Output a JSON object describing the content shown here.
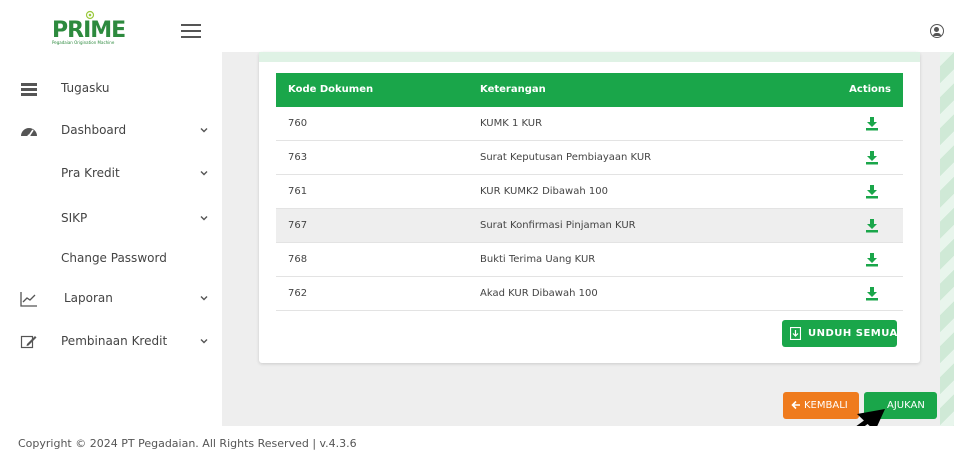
{
  "header": {
    "logo_text": "PRIME",
    "logo_subtitle": "Pegadaian Origination Machine"
  },
  "sidebar": {
    "items": [
      {
        "label": "Tugasku",
        "icon": "tasks-icon"
      },
      {
        "label": "Dashboard",
        "icon": "dashboard-icon"
      },
      {
        "label": "Pra Kredit",
        "icon": ""
      },
      {
        "label": "SIKP",
        "icon": ""
      },
      {
        "label": "Change Password",
        "icon": ""
      },
      {
        "label": "Laporan",
        "icon": "chart-icon"
      },
      {
        "label": "Pembinaan Kredit",
        "icon": "edit-icon"
      }
    ]
  },
  "table": {
    "headers": [
      "Kode Dokumen",
      "Keterangan",
      "Actions"
    ],
    "rows": [
      {
        "kode": "760",
        "keterangan": "KUMK 1 KUR"
      },
      {
        "kode": "763",
        "keterangan": "Surat Keputusan Pembiayaan KUR"
      },
      {
        "kode": "761",
        "keterangan": "KUR KUMK2 Dibawah 100"
      },
      {
        "kode": "767",
        "keterangan": "Surat Konfirmasi Pinjaman KUR"
      },
      {
        "kode": "768",
        "keterangan": "Bukti Terima Uang KUR"
      },
      {
        "kode": "762",
        "keterangan": "Akad KUR Dibawah 100"
      }
    ],
    "highlighted_row": 3
  },
  "buttons": {
    "unduh_semua": "UNDUH SEMUA",
    "kembali": "KEMBALI",
    "ajukan": "AJUKAN"
  },
  "colors": {
    "primary_green": "#1aa64a",
    "orange": "#ef7b1d"
  },
  "footer": {
    "copyright": "Copyright © 2024 PT Pegadaian. All Rights Reserved | v.4.3.6"
  }
}
